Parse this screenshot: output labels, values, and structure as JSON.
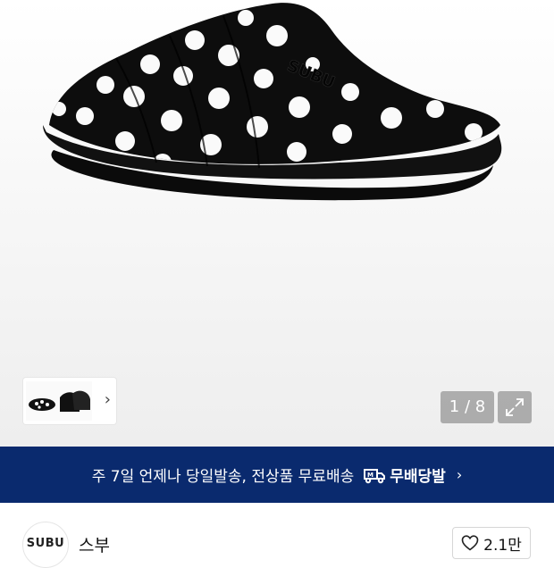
{
  "gallery": {
    "main_image": "black-polka-dot-slipper",
    "thumbnail_image": "slipper-thumbnail",
    "counter": "1 / 8",
    "next_icon": "chevron-right-icon",
    "expand_icon": "expand-icon"
  },
  "banner": {
    "text": "주 7일 언제나 당일발송, 전상품 무료배송",
    "service": "무배당발",
    "service_icon": "delivery-truck-icon",
    "chevron_icon": "chevron-right-icon",
    "background": "#0a2a6e"
  },
  "brand": {
    "logo_text": "SUBU",
    "name": "스부"
  },
  "like": {
    "icon": "heart-icon",
    "count": "2.1만"
  }
}
